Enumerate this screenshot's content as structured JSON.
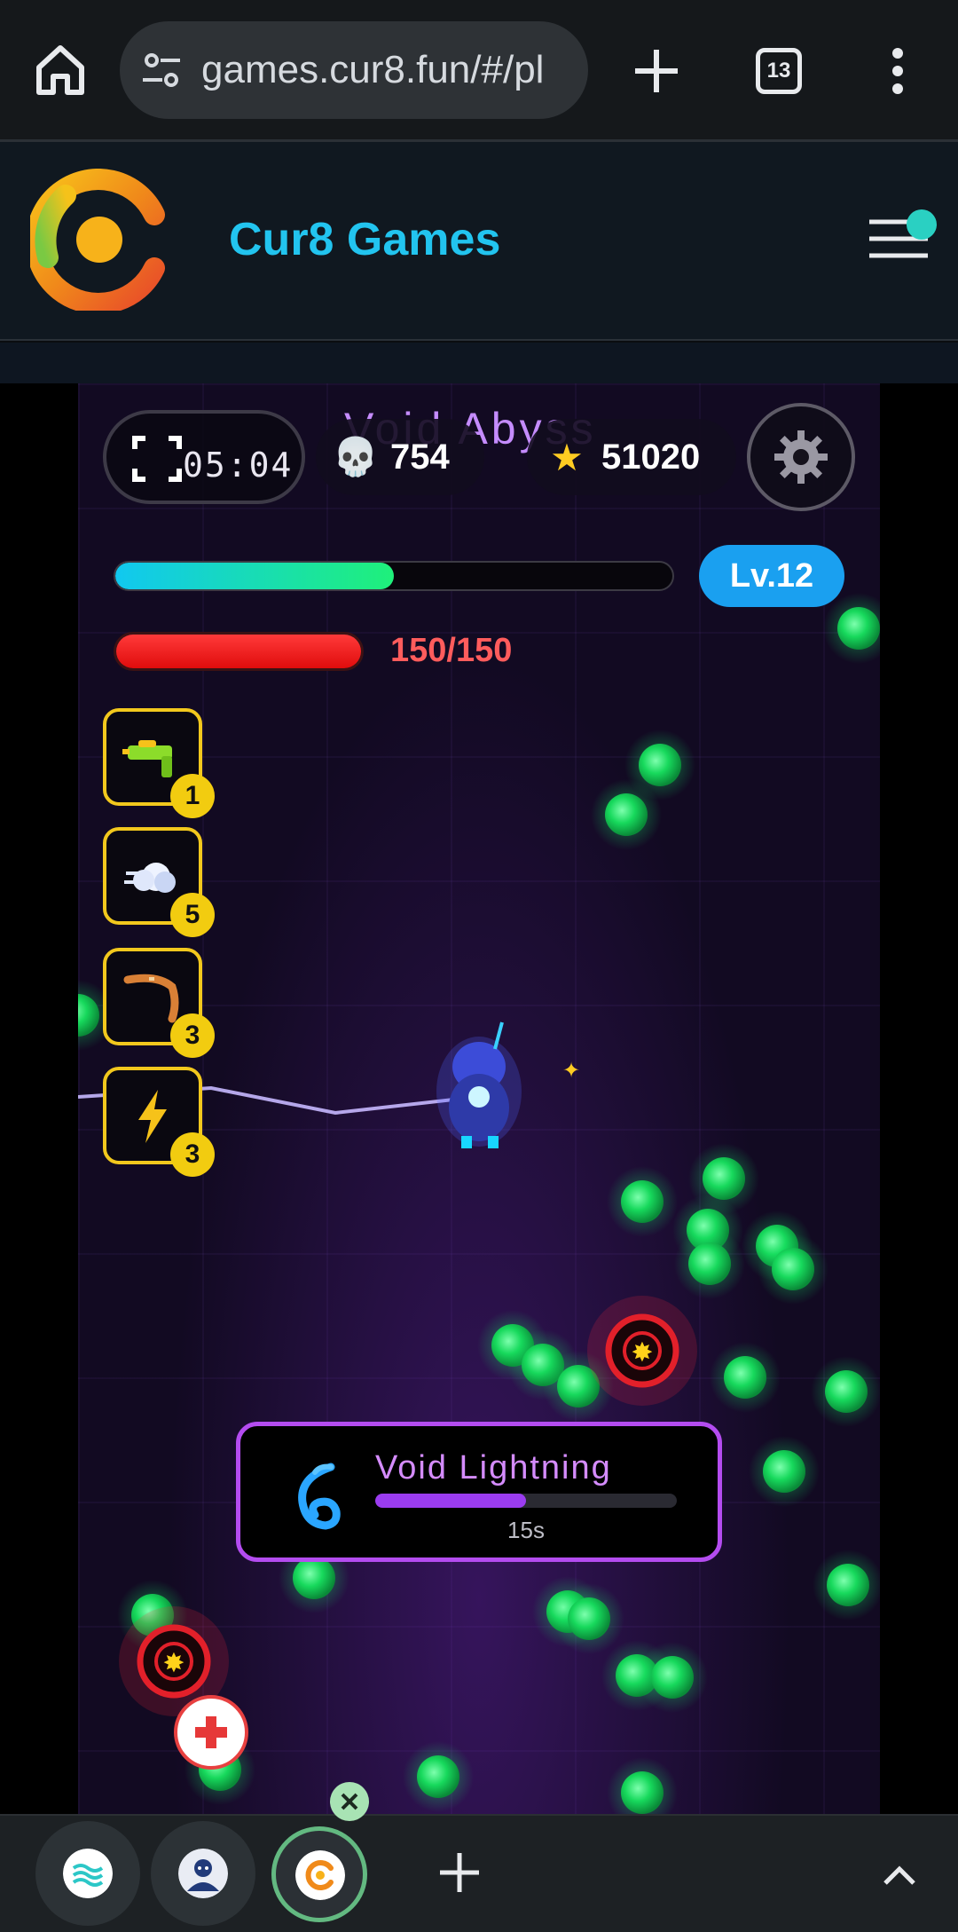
{
  "browser": {
    "url": "games.cur8.fun/#/pl",
    "tab_count": "13",
    "icons": {
      "home": "home-icon",
      "site_settings": "tune-icon",
      "new_tab": "plus-icon",
      "more": "more-vert-icon"
    }
  },
  "site": {
    "title": "Cur8 Games",
    "brand_color": "#22c4ef",
    "menu_notification": true
  },
  "game": {
    "stage_name": "Void Abyss",
    "timer": "05:04",
    "kills": "754",
    "stars": "51020",
    "level": "Lv.12",
    "xp_progress": 0.5,
    "hp_text": "150/150",
    "hp_fraction": 1.0,
    "weapons": [
      {
        "name": "water-gun",
        "icon": "water-gun-icon",
        "count": "1"
      },
      {
        "name": "dash-cloud",
        "icon": "cloud-icon",
        "count": "5"
      },
      {
        "name": "boomerang",
        "icon": "boomerang-icon",
        "count": "3"
      },
      {
        "name": "lightning",
        "icon": "lightning-icon",
        "count": "3"
      }
    ],
    "skill": {
      "name": "Void Lightning",
      "time_left": "15s",
      "progress": 0.5,
      "icon": "cyclone-icon"
    },
    "colors": {
      "skill_accent": "#b44cf0",
      "weapon_border": "#f2c81d",
      "hp": "#ff3a3a",
      "xp_start": "#11c8f0",
      "xp_end": "#1ff07a",
      "level_badge": "#1aa0f0"
    }
  },
  "tab_strip": {
    "tabs": [
      {
        "name": "tab-1",
        "icon": "waves-logo-icon",
        "active": false
      },
      {
        "name": "tab-2",
        "icon": "avatar-icon",
        "active": false
      },
      {
        "name": "tab-3",
        "icon": "cur8-logo-icon",
        "active": true
      }
    ]
  }
}
